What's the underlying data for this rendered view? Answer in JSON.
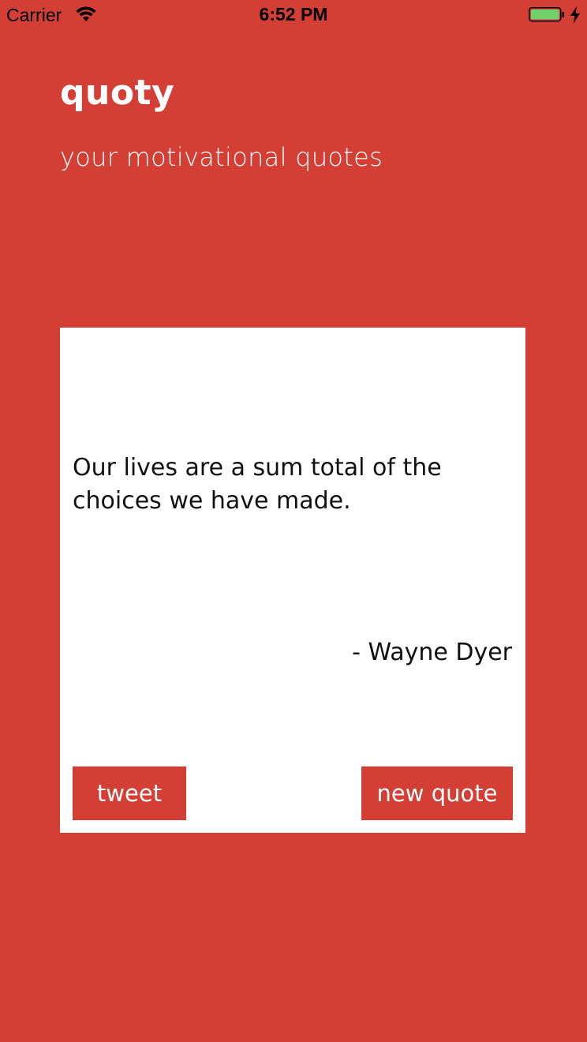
{
  "status_bar": {
    "carrier": "Carrier",
    "time": "6:52 PM",
    "wifi_icon": "wifi-icon",
    "battery_icon": "battery-icon",
    "charging_icon": "charging-bolt-icon"
  },
  "header": {
    "title": "quoty",
    "subtitle": "your motivational quotes"
  },
  "quote": {
    "text": "Our lives are a sum total of the choices we have made.",
    "author": "- Wayne Dyer"
  },
  "actions": {
    "tweet_label": "tweet",
    "new_quote_label": "new quote"
  },
  "colors": {
    "background": "#d43f35",
    "card": "#ffffff",
    "button": "#d43f35",
    "battery_fill": "#6fd16a"
  }
}
